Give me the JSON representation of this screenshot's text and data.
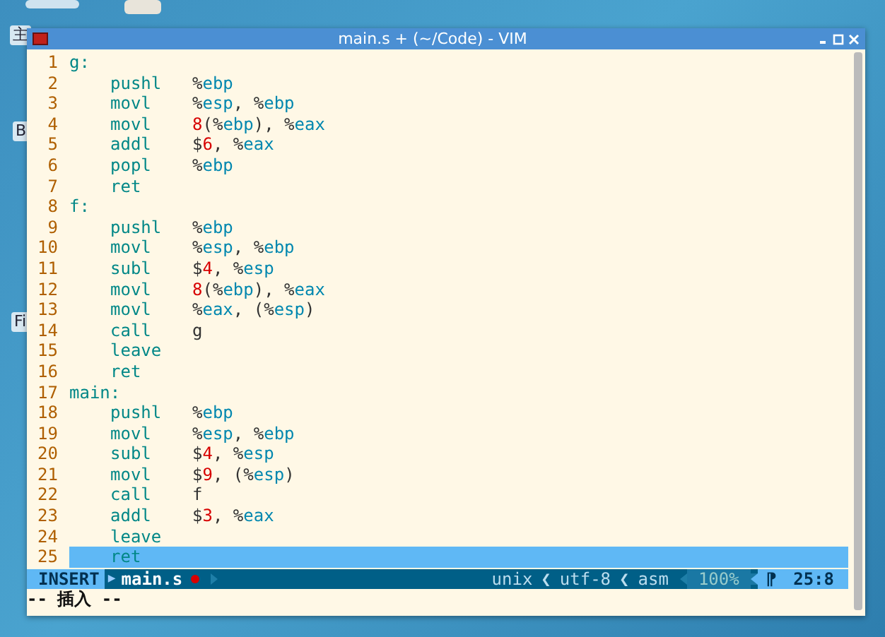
{
  "desktop_labels": [
    "主",
    "B",
    "Fi"
  ],
  "window": {
    "title": "main.s + (~/Code) - VIM"
  },
  "lines": [
    {
      "number": "1",
      "kind": "label",
      "text": "g:",
      "current": false
    },
    {
      "number": "2",
      "kind": "instr",
      "op": "pushl",
      "args": "%ebp",
      "current": false
    },
    {
      "number": "3",
      "kind": "instr",
      "op": "movl",
      "args": "%esp, %ebp",
      "current": false
    },
    {
      "number": "4",
      "kind": "instr",
      "op": "movl",
      "args": "8(%ebp), %eax",
      "current": false
    },
    {
      "number": "5",
      "kind": "instr",
      "op": "addl",
      "args": "$6, %eax",
      "current": false
    },
    {
      "number": "6",
      "kind": "instr",
      "op": "popl",
      "args": "%ebp",
      "current": false
    },
    {
      "number": "7",
      "kind": "instr",
      "op": "ret",
      "current": false
    },
    {
      "number": "8",
      "kind": "label",
      "text": "f:",
      "current": false
    },
    {
      "number": "9",
      "kind": "instr",
      "op": "pushl",
      "args": "%ebp",
      "current": false
    },
    {
      "number": "10",
      "kind": "instr",
      "op": "movl",
      "args": "%esp, %ebp",
      "current": false
    },
    {
      "number": "11",
      "kind": "instr",
      "op": "subl",
      "args": "$4, %esp",
      "current": false
    },
    {
      "number": "12",
      "kind": "instr",
      "op": "movl",
      "args": "8(%ebp), %eax",
      "current": false
    },
    {
      "number": "13",
      "kind": "instr",
      "op": "movl",
      "args": "%eax, (%esp)",
      "current": false
    },
    {
      "number": "14",
      "kind": "instr",
      "op": "call",
      "args": "g",
      "current": false
    },
    {
      "number": "15",
      "kind": "instr",
      "op": "leave",
      "current": false
    },
    {
      "number": "16",
      "kind": "instr",
      "op": "ret",
      "current": false
    },
    {
      "number": "17",
      "kind": "label",
      "text": "main:",
      "current": false
    },
    {
      "number": "18",
      "kind": "instr",
      "op": "pushl",
      "args": "%ebp",
      "current": false
    },
    {
      "number": "19",
      "kind": "instr",
      "op": "movl",
      "args": "%esp, %ebp",
      "current": false
    },
    {
      "number": "20",
      "kind": "instr",
      "op": "subl",
      "args": "$4, %esp",
      "current": false
    },
    {
      "number": "21",
      "kind": "instr",
      "op": "movl",
      "args": "$9, (%esp)",
      "current": false
    },
    {
      "number": "22",
      "kind": "instr",
      "op": "call",
      "args": "f",
      "current": false
    },
    {
      "number": "23",
      "kind": "instr",
      "op": "addl",
      "args": "$3, %eax",
      "current": false
    },
    {
      "number": "24",
      "kind": "instr",
      "op": "leave",
      "current": false
    },
    {
      "number": "25",
      "kind": "instr",
      "op": "ret",
      "current": true
    }
  ],
  "status_line": {
    "mode": "INSERT",
    "arrow": "▶",
    "file": "main.s",
    "modified": true,
    "fileformat": "unix",
    "sep1": "❮",
    "encoding": "utf-8",
    "sep2": "❮",
    "filetype": "asm",
    "percent": "100%",
    "line_symbol": "⁋",
    "position": "25:8"
  },
  "command_line": "-- 插入 --"
}
